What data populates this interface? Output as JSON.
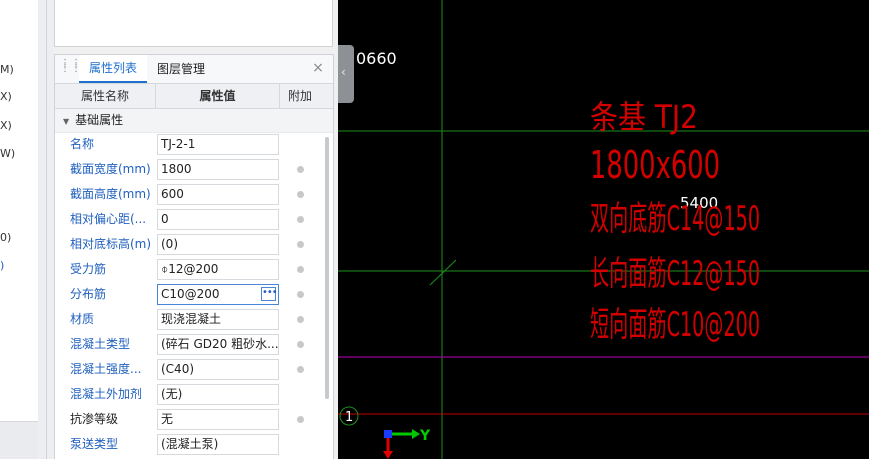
{
  "left_strip": {
    "fragments": [
      "M)",
      "X)",
      "X)",
      "W)",
      "0)",
      ")"
    ]
  },
  "panel": {
    "tabs": [
      "属性列表",
      "图层管理"
    ],
    "close_icon": "close-icon",
    "columns": {
      "name": "属性名称",
      "value": "属性值",
      "attach": "附加"
    },
    "section_title": "基础属性",
    "rows": [
      {
        "name": "名称",
        "value": "TJ-2-1"
      },
      {
        "name": "截面宽度(mm)",
        "value": "1800"
      },
      {
        "name": "截面高度(mm)",
        "value": "600"
      },
      {
        "name": "相对偏心距(...",
        "value": "0"
      },
      {
        "name": "相对底标高(m)",
        "value": "(0)"
      },
      {
        "name": "受力筋",
        "value": "⌽12@200"
      },
      {
        "name": "分布筋",
        "value": "C10@200"
      },
      {
        "name": "材质",
        "value": "现浇混凝土"
      },
      {
        "name": "混凝土类型",
        "value": "(碎石 GD20 粗砂水..."
      },
      {
        "name": "混凝土强度...",
        "value": "(C40)"
      },
      {
        "name": "混凝土外加剂",
        "value": "(无)"
      },
      {
        "name": "抗渗等级",
        "value": "无"
      },
      {
        "name": "泵送类型",
        "value": "(混凝土泵)"
      }
    ]
  },
  "canvas": {
    "dimension_top": "0660",
    "dimension_mid": "5400",
    "annotation": [
      "条基 TJ2",
      "1800x600",
      "双向底筋C14@150",
      "长向面筋C12@150",
      "短向面筋C10@200"
    ],
    "axis_bubble": "1",
    "axis_y_label": "Y",
    "colors": {
      "background": "#000000",
      "green_line": "#1e8f1e",
      "magenta_line": "#c000c0",
      "red_line": "#c00000",
      "annotation_red": "#d40000",
      "text_white": "#ffffff"
    }
  }
}
